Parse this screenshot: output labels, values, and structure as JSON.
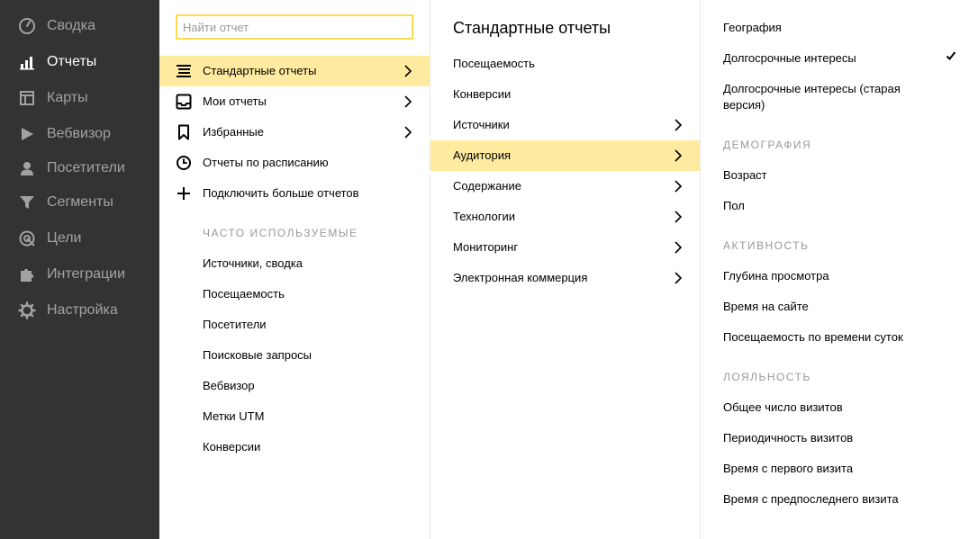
{
  "sidebar": {
    "items": [
      {
        "label": "Сводка",
        "icon": "dashboard-icon",
        "active": false
      },
      {
        "label": "Отчеты",
        "icon": "bar-chart-icon",
        "active": true
      },
      {
        "label": "Карты",
        "icon": "map-layout-icon",
        "active": false
      },
      {
        "label": "Вебвизор",
        "icon": "play-icon",
        "active": false
      },
      {
        "label": "Посетители",
        "icon": "user-icon",
        "active": false
      },
      {
        "label": "Сегменты",
        "icon": "filter-icon",
        "active": false
      },
      {
        "label": "Цели",
        "icon": "target-icon",
        "active": false
      },
      {
        "label": "Интеграции",
        "icon": "puzzle-icon",
        "active": false
      },
      {
        "label": "Настройка",
        "icon": "gear-icon",
        "active": false
      }
    ]
  },
  "col1": {
    "search_placeholder": "Найти отчет",
    "menu": [
      {
        "label": "Стандартные отчеты",
        "icon": "list-icon",
        "has_submenu": true,
        "highlighted": true
      },
      {
        "label": "Мои отчеты",
        "icon": "inbox-icon",
        "has_submenu": true,
        "highlighted": false
      },
      {
        "label": "Избранные",
        "icon": "bookmark-icon",
        "has_submenu": true,
        "highlighted": false
      },
      {
        "label": "Отчеты по расписанию",
        "icon": "clock-icon",
        "has_submenu": false,
        "highlighted": false
      },
      {
        "label": "Подключить больше отчетов",
        "icon": "plus-icon",
        "has_submenu": false,
        "highlighted": false
      }
    ],
    "frequent_heading": "ЧАСТО ИСПОЛЬЗУЕМЫЕ",
    "frequent": [
      "Источники, сводка",
      "Посещаемость",
      "Посетители",
      "Поисковые запросы",
      "Вебвизор",
      "Метки UTM",
      "Конверсии"
    ]
  },
  "col2": {
    "title": "Стандартные отчеты",
    "items": [
      {
        "label": "Посещаемость",
        "has_submenu": false,
        "highlighted": false
      },
      {
        "label": "Конверсии",
        "has_submenu": false,
        "highlighted": false
      },
      {
        "label": "Источники",
        "has_submenu": true,
        "highlighted": false
      },
      {
        "label": "Аудитория",
        "has_submenu": true,
        "highlighted": true
      },
      {
        "label": "Содержание",
        "has_submenu": true,
        "highlighted": false
      },
      {
        "label": "Технологии",
        "has_submenu": true,
        "highlighted": false
      },
      {
        "label": "Мониторинг",
        "has_submenu": true,
        "highlighted": false
      },
      {
        "label": "Электронная коммерция",
        "has_submenu": true,
        "highlighted": false
      }
    ]
  },
  "col3": {
    "top_items": [
      {
        "label": "География",
        "checked": false
      },
      {
        "label": "Долгосрочные интересы",
        "checked": true
      },
      {
        "label": "Долгосрочные интересы (старая версия)",
        "checked": false
      }
    ],
    "sections": [
      {
        "heading": "ДЕМОГРАФИЯ",
        "items": [
          "Возраст",
          "Пол"
        ]
      },
      {
        "heading": "АКТИВНОСТЬ",
        "items": [
          "Глубина просмотра",
          "Время на сайте",
          "Посещаемость по времени суток"
        ]
      },
      {
        "heading": "ЛОЯЛЬНОСТЬ",
        "items": [
          "Общее число визитов",
          "Периодичность визитов",
          "Время с первого визита",
          "Время с предпоследнего визита"
        ]
      }
    ]
  },
  "colors": {
    "sidebar_bg": "#333333",
    "sidebar_text": "#a2a2a2",
    "sidebar_active_text": "#ffffff",
    "highlight": "#ffeba0",
    "search_border": "#ffdb4d",
    "section_heading": "#999999"
  }
}
